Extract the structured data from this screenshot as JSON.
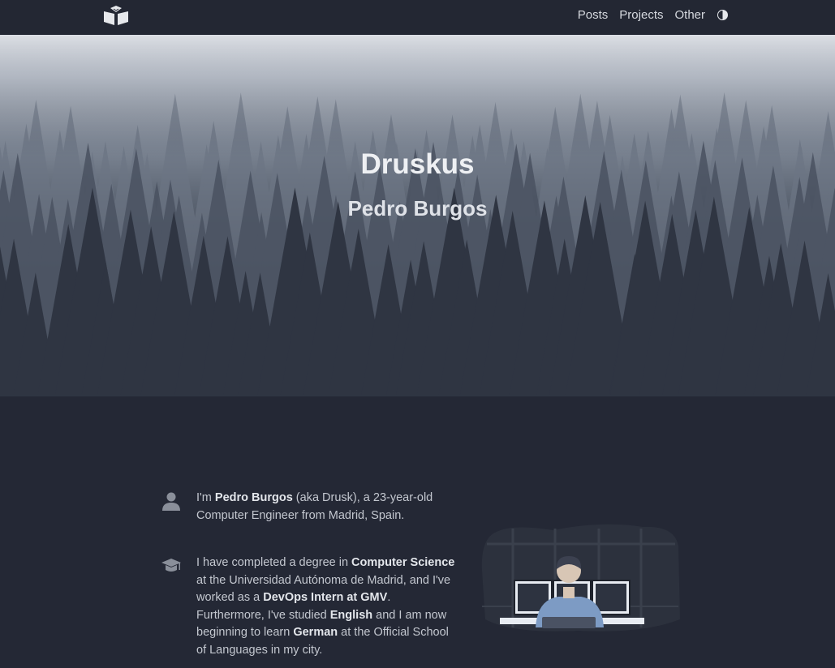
{
  "nav": {
    "logo_icon": "open-book-icon",
    "links": [
      {
        "label": "Posts"
      },
      {
        "label": "Projects"
      },
      {
        "label": "Other"
      }
    ],
    "theme_toggle_icon": "half-circle-contrast-icon"
  },
  "hero": {
    "title": "Druskus",
    "subtitle": "Pedro Burgos"
  },
  "about": {
    "items": [
      {
        "icon": "user-icon",
        "parts": [
          {
            "text": "I'm ",
            "bold": false
          },
          {
            "text": "Pedro Burgos",
            "bold": true
          },
          {
            "text": " (aka Drusk), a 23-year-old Computer Engineer from Madrid, Spain.",
            "bold": false
          }
        ]
      },
      {
        "icon": "graduation-cap-icon",
        "parts": [
          {
            "text": "I have completed a degree in ",
            "bold": false
          },
          {
            "text": "Computer Science",
            "bold": true
          },
          {
            "text": " at the Universidad Autónoma de Madrid, and I've worked as a ",
            "bold": false
          },
          {
            "text": "DevOps Intern at GMV",
            "bold": true
          },
          {
            "text": ". Furthermore, I've studied ",
            "bold": false
          },
          {
            "text": "English",
            "bold": true
          },
          {
            "text": " and I am now beginning to learn ",
            "bold": false
          },
          {
            "text": "German",
            "bold": true
          },
          {
            "text": " at the Official School of Languages in my city.",
            "bold": false
          }
        ]
      }
    ]
  },
  "colors": {
    "background": "#242835",
    "navbar": "#232733",
    "text": "#c3c7cf",
    "accent_blue": "#7d9bc4"
  }
}
